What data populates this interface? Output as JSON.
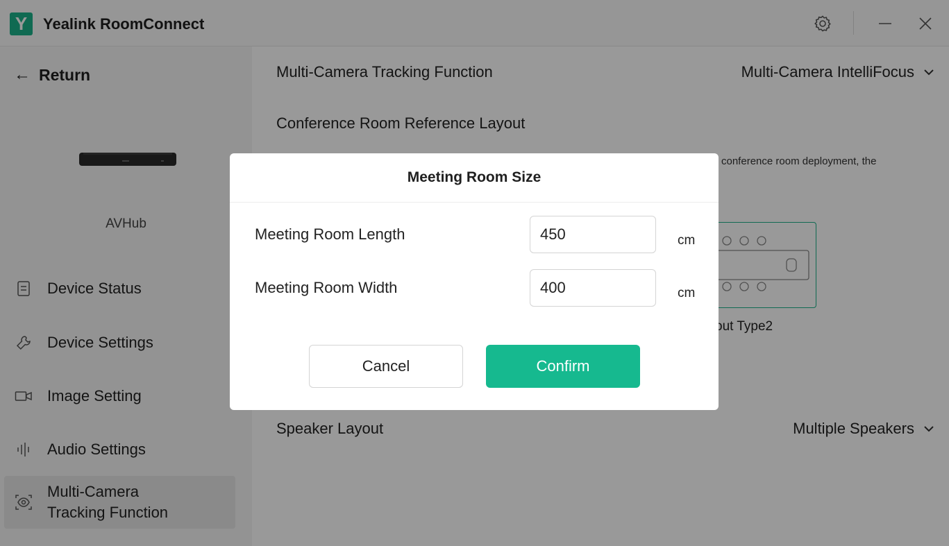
{
  "app": {
    "title": "Yealink RoomConnect",
    "logo_letter": "Y"
  },
  "titlebar": {
    "settings_icon": "gear-icon",
    "minimize_icon": "minimize-icon",
    "close_icon": "close-icon"
  },
  "sidebar": {
    "return_label": "Return",
    "device_name": "AVHub",
    "items": [
      {
        "label": "Device Status",
        "icon": "document-icon",
        "active": false
      },
      {
        "label": "Device Settings",
        "icon": "wrench-icon",
        "active": false
      },
      {
        "label": "Image Setting",
        "icon": "camera-icon",
        "active": false
      },
      {
        "label": "Audio Settings",
        "icon": "audio-bars-icon",
        "active": false
      },
      {
        "label_line1": "Multi-Camera",
        "label_line2": "Tracking Function",
        "icon": "eye-tracking-icon",
        "active": true
      }
    ]
  },
  "main": {
    "tracking_label": "Multi-Camera Tracking Function",
    "tracking_value": "Multi-Camera IntelliFocus",
    "reference_layout_label": "Conference Room Reference Layout",
    "hint_text": "conference room deployment, the",
    "layout_caption": "out Type2",
    "speaker_layout_label": "Speaker Layout",
    "speaker_layout_value": "Multiple Speakers"
  },
  "dialog": {
    "title": "Meeting Room Size",
    "length_label": "Meeting Room Length",
    "length_value": "450",
    "width_label": "Meeting Room Width",
    "width_value": "400",
    "unit": "cm",
    "cancel_label": "Cancel",
    "confirm_label": "Confirm"
  },
  "colors": {
    "accent": "#16b98f",
    "overlay": "rgba(0,0,0,0.40)"
  }
}
